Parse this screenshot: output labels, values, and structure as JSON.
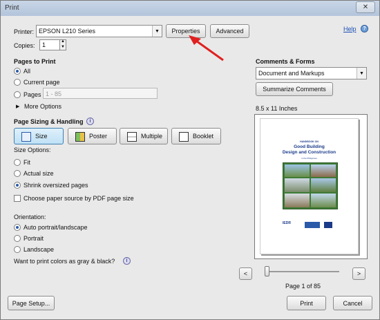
{
  "window": {
    "title": "Print",
    "close_label": "✕"
  },
  "help": {
    "label": "Help",
    "icon": "help-icon"
  },
  "printer": {
    "label": "Printer:",
    "selected": "EPSON L210 Series",
    "properties_label": "Properties",
    "advanced_label": "Advanced"
  },
  "copies": {
    "label": "Copies:",
    "value": "1"
  },
  "pages": {
    "title": "Pages to Print",
    "all": "All",
    "current": "Current page",
    "pages": "Pages",
    "range_placeholder": "1 - 85",
    "more": "More Options",
    "selected": "All"
  },
  "sizing": {
    "title": "Page Sizing & Handling",
    "buttons": [
      "Size",
      "Poster",
      "Multiple",
      "Booklet"
    ],
    "active": "Size",
    "options_label": "Size Options:",
    "fit": "Fit",
    "actual": "Actual size",
    "shrink": "Shrink oversized pages",
    "selected": "Shrink oversized pages",
    "choose_source": "Choose paper source by PDF page size"
  },
  "orientation": {
    "label": "Orientation:",
    "auto": "Auto portrait/landscape",
    "portrait": "Portrait",
    "landscape": "Landscape",
    "selected": "Auto portrait/landscape",
    "gray_question": "Want to print colors as gray & black?"
  },
  "comments": {
    "title": "Comments & Forms",
    "selected": "Document and Markups",
    "summarize_label": "Summarize Comments"
  },
  "preview": {
    "paper": "8.5 x 11 Inches",
    "doc_kicker": "HANDBOOK ON",
    "doc_title_line1": "Good Building",
    "doc_title_line2": "Design and Construction",
    "doc_subtitle": "in the Philippines",
    "doc_logo": "IEDR",
    "page_status": "Page 1 of 85",
    "prev": "<",
    "next": ">"
  },
  "footer": {
    "page_setup": "Page Setup...",
    "print": "Print",
    "cancel": "Cancel"
  },
  "colors": {
    "accent": "#3c7fb1",
    "link": "#1a4fb5",
    "arrow": "#e02020"
  }
}
